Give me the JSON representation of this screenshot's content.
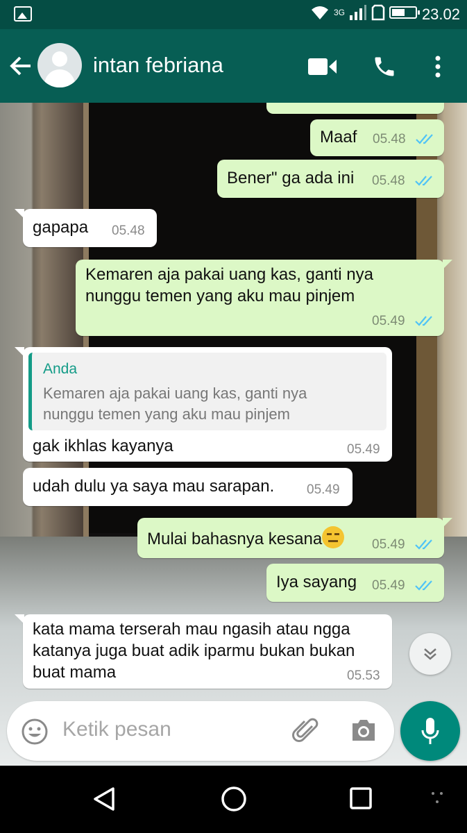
{
  "status_bar": {
    "network": "3G",
    "time": "23.02"
  },
  "header": {
    "contact_name": "intan febriana"
  },
  "messages": [
    {
      "text": "Maaf",
      "time": "05.48"
    },
    {
      "text": "Bener\" ga ada ini",
      "time": "05.48"
    },
    {
      "text": "gapapa",
      "time": "05.48"
    },
    {
      "line1": "Kemaren aja pakai uang kas, ganti nya",
      "line2": "nunggu temen yang aku mau pinjem",
      "time": "05.49"
    },
    {
      "quote_author": "Anda",
      "quote_line1": "Kemaren aja pakai uang kas, ganti nya",
      "quote_line2": "nunggu temen yang aku mau pinjem",
      "text": "gak ikhlas kayanya",
      "time": "05.49"
    },
    {
      "text": "udah dulu ya saya mau sarapan.",
      "time": "05.49"
    },
    {
      "text": "Mulai bahasnya kesana",
      "emoji": "expressionless-face",
      "time": "05.49"
    },
    {
      "text": "Iya sayang",
      "time": "05.49"
    },
    {
      "line1": "kata mama terserah mau ngasih atau ngga",
      "line2": "katanya juga buat adik iparmu bukan bukan",
      "line3": "buat mama",
      "time": "05.53"
    }
  ],
  "composer": {
    "placeholder": "Ketik pesan"
  },
  "icons": {
    "back": "arrow-left-icon",
    "video": "video-camera-icon",
    "call": "phone-icon",
    "menu": "more-vertical-icon",
    "emoji": "smiley-icon",
    "attach": "paperclip-icon",
    "camera": "camera-icon",
    "mic": "microphone-icon",
    "scroll": "double-chevron-down-icon",
    "read": "double-check-icon"
  },
  "colors": {
    "header": "#075e54",
    "status_bar": "#054d44",
    "outgoing": "#dcf8c6",
    "incoming": "#ffffff",
    "accent": "#00897b",
    "read_ticks": "#4fc3f7"
  }
}
